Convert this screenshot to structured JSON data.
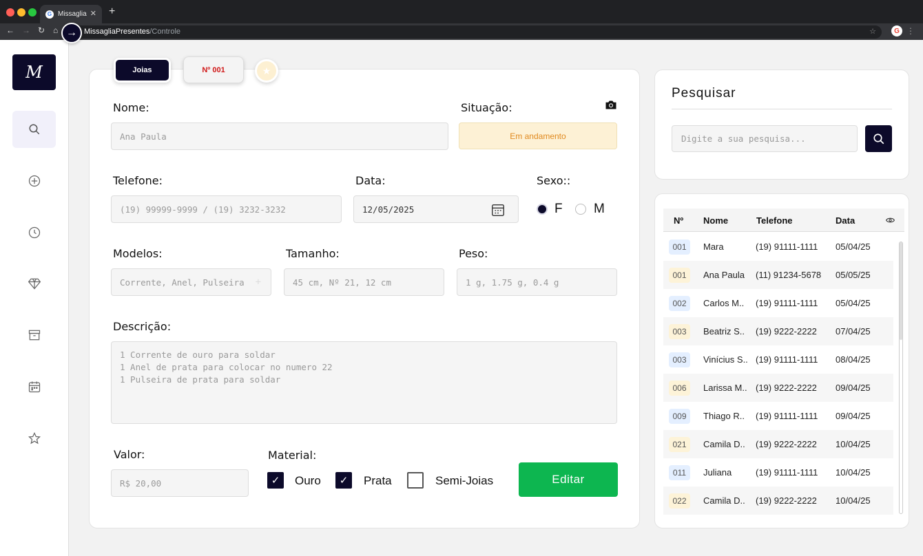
{
  "browser": {
    "tab_title": "Missaglia",
    "url_host": "MissagliaPresentes",
    "url_path": "/Controle"
  },
  "sidebar": {
    "logo_text": "M",
    "items": [
      {
        "icon": "search-icon"
      },
      {
        "icon": "plus-circle-icon"
      },
      {
        "icon": "clock-icon"
      },
      {
        "icon": "diamond-icon"
      },
      {
        "icon": "archive-icon"
      },
      {
        "icon": "calendar-icon"
      },
      {
        "icon": "star-icon"
      }
    ]
  },
  "form": {
    "tab_joias": "Joias",
    "tab_number": "Nº 001",
    "nome_label": "Nome:",
    "nome_value": "Ana Paula",
    "situacao_label": "Situação:",
    "situacao_value": "Em andamento",
    "telefone_label": "Telefone:",
    "telefone_placeholder": "(19) 99999-9999 / (19) 3232-3232",
    "data_label": "Data:",
    "data_value": "12/05/2025",
    "sexo_label": "Sexo::",
    "sexo_f": "F",
    "sexo_m": "M",
    "sexo_selected": "F",
    "modelos_label": "Modelos:",
    "modelos_placeholder": "Corrente, Anel, Pulseira",
    "tamanho_label": "Tamanho:",
    "tamanho_placeholder": "45 cm, Nº 21, 12 cm",
    "peso_label": "Peso:",
    "peso_placeholder": "1 g, 1.75 g, 0.4 g",
    "descricao_label": "Descrição:",
    "descricao_lines": [
      "1 Corrente de ouro para soldar",
      "1 Anel de prata para colocar no numero 22",
      "1 Pulseira de prata para soldar"
    ],
    "valor_label": "Valor:",
    "valor_placeholder": "R$ 20,00",
    "material_label": "Material:",
    "material_ouro": "Ouro",
    "material_prata": "Prata",
    "material_semi": "Semi-Joias",
    "material_checked": {
      "ouro": true,
      "prata": true,
      "semi": false
    },
    "edit_button": "Editar"
  },
  "search": {
    "title": "Pesquisar",
    "placeholder": "Digite a sua pesquisa..."
  },
  "table": {
    "headers": [
      "Nº",
      "Nome",
      "Telefone",
      "Data"
    ],
    "rows": [
      {
        "num": "001",
        "nome": "Mara",
        "telefone": "(19) 91111-1111",
        "data": "05/04/25",
        "badge": "blue"
      },
      {
        "num": "001",
        "nome": "Ana Paula",
        "telefone": "(11) 91234-5678",
        "data": "05/05/25",
        "badge": "yellow"
      },
      {
        "num": "002",
        "nome": "Carlos M..",
        "telefone": "(19) 91111-1111",
        "data": "05/04/25",
        "badge": "blue"
      },
      {
        "num": "003",
        "nome": "Beatriz S..",
        "telefone": "(19) 9222-2222",
        "data": "07/04/25",
        "badge": "yellow"
      },
      {
        "num": "003",
        "nome": "Vinícius S..",
        "telefone": "(19) 91111-1111",
        "data": "08/04/25",
        "badge": "blue"
      },
      {
        "num": "006",
        "nome": "Larissa M..",
        "telefone": "(19) 9222-2222",
        "data": "09/04/25",
        "badge": "yellow"
      },
      {
        "num": "009",
        "nome": "Thiago R..",
        "telefone": "(19) 91111-1111",
        "data": "09/04/25",
        "badge": "blue"
      },
      {
        "num": "021",
        "nome": "Camila D..",
        "telefone": "(19) 9222-2222",
        "data": "10/04/25",
        "badge": "yellow"
      },
      {
        "num": "011",
        "nome": "Juliana",
        "telefone": "(19) 91111-1111",
        "data": "10/04/25",
        "badge": "blue"
      },
      {
        "num": "022",
        "nome": "Camila D..",
        "telefone": "(19) 9222-2222",
        "data": "10/04/25",
        "badge": "yellow"
      }
    ]
  },
  "colors": {
    "brand_dark": "#0c0a2a",
    "edit_green": "#0db650",
    "status_bg": "#fdf1d5",
    "status_text": "#e0891e",
    "number_red": "#d01818"
  }
}
